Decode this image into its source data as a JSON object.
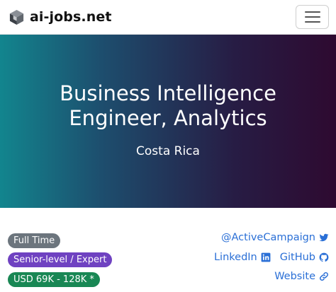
{
  "navbar": {
    "brand": "ai-jobs.net",
    "logo_icon": "cube-logo-icon",
    "menu_icon": "hamburger-menu-icon"
  },
  "hero": {
    "title": "Business Intelligence Engineer, Analytics",
    "location": "Costa Rica"
  },
  "badges": {
    "employment": "Full Time",
    "level": "Senior-level / Expert",
    "salary": "USD 69K - 128K *"
  },
  "links": {
    "company": "@ActiveCampaign",
    "linkedin": "LinkedIn",
    "github": "GitHub",
    "website": "Website"
  },
  "colors": {
    "link": "#2a6fd6",
    "badge_employment": "#6c757d",
    "badge_level": "#6f42c1",
    "badge_salary": "#198754"
  }
}
